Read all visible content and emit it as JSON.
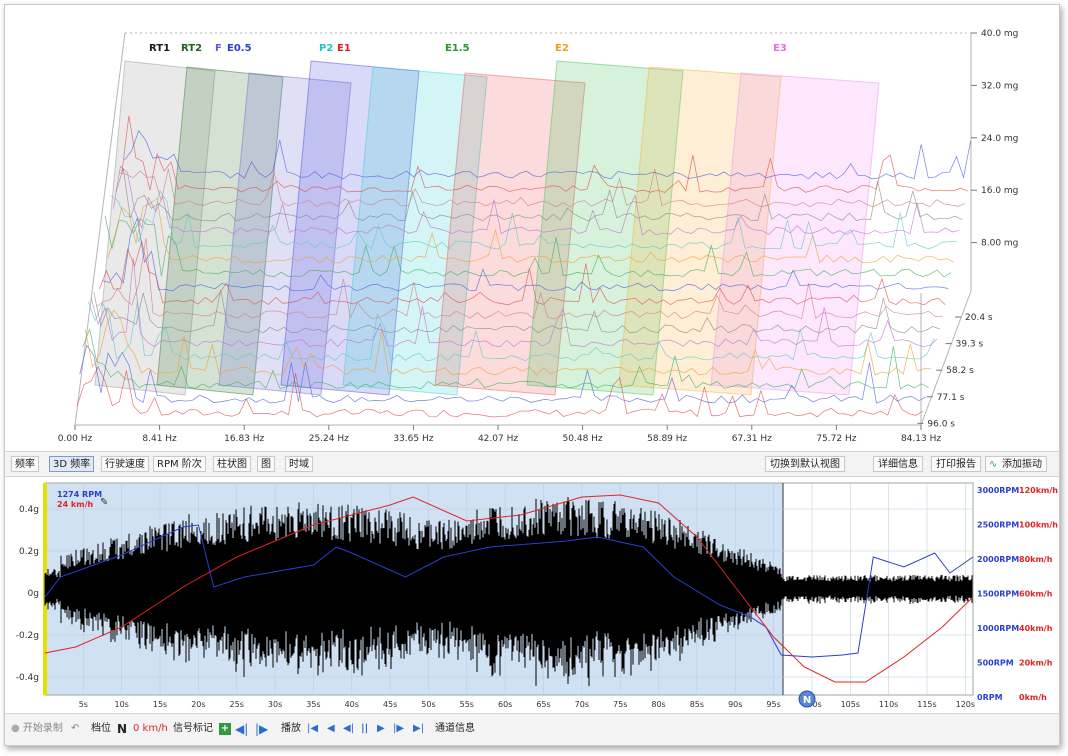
{
  "spectrum_3d": {
    "x_ticks": [
      "0.00 Hz",
      "8.41 Hz",
      "16.83 Hz",
      "25.24 Hz",
      "33.65 Hz",
      "42.07 Hz",
      "50.48 Hz",
      "58.89 Hz",
      "67.31 Hz",
      "75.72 Hz",
      "84.13 Hz"
    ],
    "z_ticks": [
      "40.0 mg",
      "32.0 mg",
      "24.0 mg",
      "16.0 mg",
      "8.00 mg"
    ],
    "t_ticks": [
      "20.4 s",
      "39.3 s",
      "58.2 s",
      "77.1 s",
      "96.0 s"
    ],
    "order_labels": [
      {
        "text": "RT1",
        "color": "#1b1b1b"
      },
      {
        "text": "RT2",
        "color": "#1f5f1f"
      },
      {
        "text": "F",
        "color": "#7a4fd8"
      },
      {
        "text": "E0.5",
        "color": "#2a3fd0"
      },
      {
        "text": "P2",
        "color": "#23c4c4"
      },
      {
        "text": "E1",
        "color": "#e02424"
      },
      {
        "text": "E1.5",
        "color": "#1f9b2f"
      },
      {
        "text": "E2",
        "color": "#f0a020"
      },
      {
        "text": "E3",
        "color": "#e070e0"
      }
    ]
  },
  "toolbar": {
    "tabs": [
      "频率",
      "3D 频率",
      "行驶速度",
      "RPM 阶次",
      "柱状图",
      "图",
      "时域"
    ],
    "active_tab": "3D 频率",
    "actions": [
      "切换到默认视图",
      "详细信息",
      "打印报告",
      "添加振动"
    ]
  },
  "waveform": {
    "readout_rpm": "1274 RPM",
    "readout_speed": "24 km/h",
    "y_ticks": [
      "0.4g",
      "0.2g",
      "0g",
      "-0.2g",
      "-0.4g"
    ],
    "x_ticks": [
      "5s",
      "10s",
      "15s",
      "20s",
      "25s",
      "30s",
      "35s",
      "40s",
      "45s",
      "50s",
      "55s",
      "60s",
      "65s",
      "70s",
      "75s",
      "80s",
      "85s",
      "90s",
      "95s",
      "100s",
      "105s",
      "110s",
      "115s",
      "120s"
    ],
    "rpm_ticks": [
      "3000RPM",
      "2500RPM",
      "2000RPM",
      "1500RPM",
      "1000RPM",
      "500RPM",
      "0RPM"
    ],
    "speed_ticks": [
      "120km/h",
      "100km/h",
      "80km/h",
      "60km/h",
      "40km/h",
      "20km/h",
      "0km/h"
    ],
    "marker_label": "N",
    "colors": {
      "rpm": "#2a3fd0",
      "speed": "#e02424",
      "signal": "#000000",
      "selection": "#cfe1f3"
    }
  },
  "bottom_bar": {
    "record": "开始录制",
    "gear_label": "档位",
    "gear_value": "N",
    "speed_value": "0 km/h",
    "signal_mark": "信号标记",
    "play": "播放",
    "channel_info": "通道信息"
  }
}
